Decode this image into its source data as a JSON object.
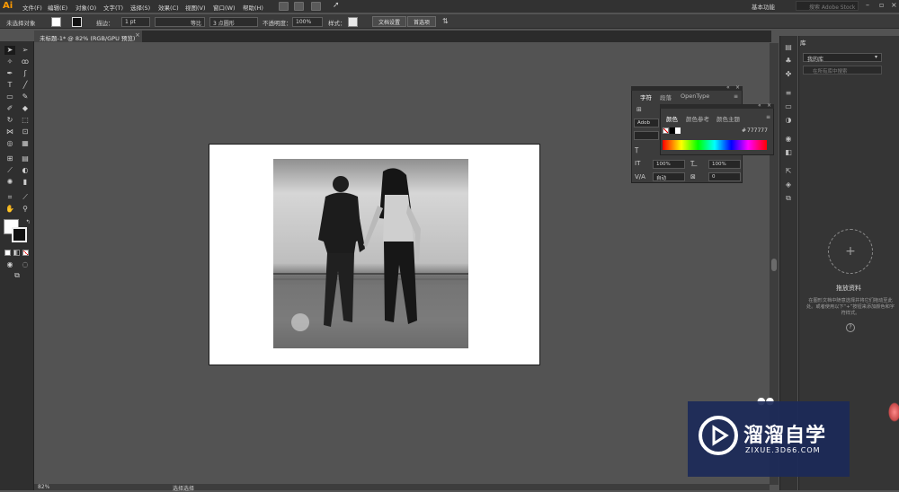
{
  "app": {
    "logo": "Ai"
  },
  "menubar": {
    "items": [
      "文件(F)",
      "编辑(E)",
      "对象(O)",
      "文字(T)",
      "选择(S)",
      "效果(C)",
      "视图(V)",
      "窗口(W)",
      "帮助(H)"
    ],
    "workspace": "基本功能",
    "search_placeholder": "搜索 Adobe Stock"
  },
  "controlbar": {
    "selection": "未选择对象",
    "stroke_label": "描边：",
    "stroke_weight": "1 pt",
    "stroke_profile": "等比",
    "brush": "3 点圆形",
    "opacity_label": "不透明度：",
    "opacity": "100%",
    "style_label": "样式：",
    "doc_setup": "文档设置",
    "preferences": "首选项"
  },
  "document": {
    "tab_title": "未标题-1* @ 82% (RGB/GPU 预览)",
    "close_glyph": "×",
    "zoom": "82%",
    "status": "选择选择"
  },
  "character_panel": {
    "tabs": [
      "字符",
      "段落",
      "OpenType"
    ],
    "font_search": "Adob",
    "size_scale_v": "100%",
    "size_scale_h": "100%",
    "leading": "自动",
    "tracking": "0"
  },
  "color_panel": {
    "tabs": [
      "颜色",
      "颜色参考",
      "颜色主题"
    ],
    "hex_label": "#",
    "hex": "777777"
  },
  "libraries_panel": {
    "tab": "库",
    "library": "我的库",
    "search_placeholder": "在所有库中搜索",
    "drop_title": "拖放资料",
    "drop_description": "在图形文档中随意选择并将它们拖动至此处。或者使用以下“+”按钮来添加颜色和字符样式。",
    "add_glyph": "+",
    "help_glyph": "?"
  },
  "watermark": {
    "title": "溜溜自学",
    "subtitle": "ZIXUE.3D66.COM"
  },
  "colors": {
    "app_bg": "#535353",
    "panel_bg": "#3c3c3c",
    "menubar_bg": "#323232",
    "accent_orange": "#ff9a00",
    "watermark_bg": "#1c2a58"
  },
  "icons": {
    "toolbar": [
      "selection-icon",
      "direct-selection-icon",
      "magic-wand-icon",
      "lasso-icon",
      "pen-icon",
      "curvature-icon",
      "type-icon",
      "line-icon",
      "rectangle-icon",
      "paintbrush-icon",
      "shaper-icon",
      "eraser-icon",
      "rotate-icon",
      "scale-icon",
      "width-icon",
      "free-transform-icon",
      "shape-builder-icon",
      "perspective-icon",
      "mesh-icon",
      "gradient-icon",
      "eyedropper-icon",
      "blend-icon",
      "symbol-sprayer-icon",
      "column-graph-icon",
      "artboard-icon",
      "slice-icon",
      "hand-icon",
      "zoom-icon"
    ]
  }
}
